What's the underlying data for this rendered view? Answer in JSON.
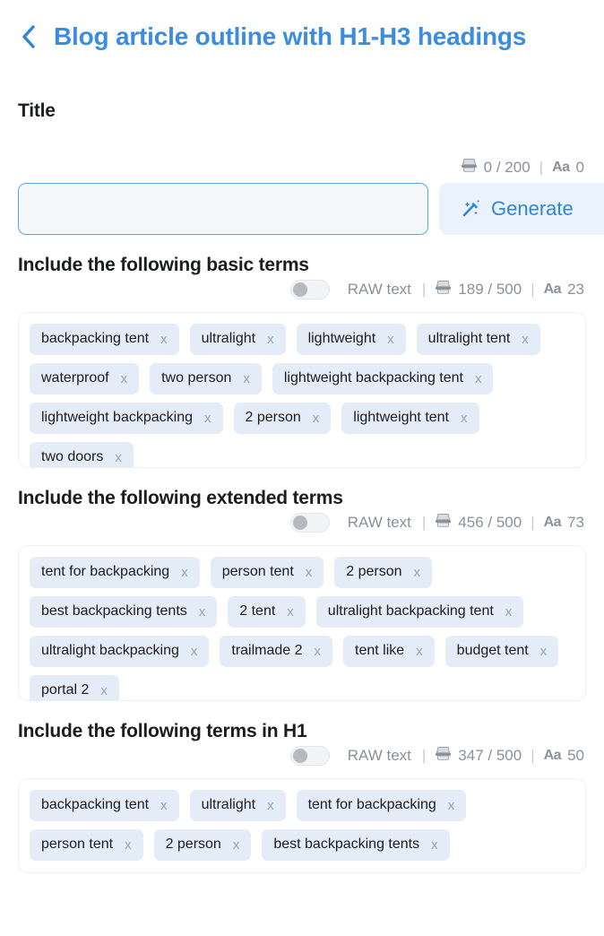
{
  "header": {
    "back_icon": "chevron-left-icon",
    "title": "Blog article outline with H1-H3 headings"
  },
  "title_section": {
    "label": "Title",
    "char_icon": "typewriter-icon",
    "char_count": "0 / 200",
    "word_icon_label": "Aa",
    "word_count": "0",
    "input_value": "",
    "input_placeholder": "",
    "generate_label": "Generate",
    "generate_icon": "magic-wand-icon"
  },
  "sections": [
    {
      "heading": "Include the following basic terms",
      "toggle_label": "RAW text",
      "toggle_state": "off",
      "char_count": "189 / 500",
      "word_icon_label": "Aa",
      "word_count": "23",
      "terms": [
        "backpacking tent",
        "ultralight",
        "lightweight",
        "ultralight tent",
        "waterproof",
        "two person",
        "lightweight backpacking tent",
        "lightweight backpacking",
        "2 person",
        "lightweight tent",
        "two doors"
      ]
    },
    {
      "heading": "Include the following extended terms",
      "toggle_label": "RAW text",
      "toggle_state": "off",
      "char_count": "456 / 500",
      "word_icon_label": "Aa",
      "word_count": "73",
      "terms": [
        "tent for backpacking",
        "person tent",
        "2 person",
        "best backpacking tents",
        "2 tent",
        "ultralight backpacking tent",
        "ultralight backpacking",
        "trailmade 2",
        "tent like",
        "budget tent",
        "portal 2"
      ]
    },
    {
      "heading": "Include the following terms in H1",
      "toggle_label": "RAW text",
      "toggle_state": "off",
      "char_count": "347 / 500",
      "word_icon_label": "Aa",
      "word_count": "50",
      "terms": [
        "backpacking tent",
        "ultralight",
        "tent for backpacking",
        "person tent",
        "2 person",
        "best backpacking tents"
      ]
    }
  ],
  "chip_remove_label": "x",
  "colors": {
    "accent_blue": "#2f86d6",
    "title_blue": "#3c8dde",
    "chip_bg": "#e4ecf8",
    "generate_bg": "#e9f2fd",
    "text_dark": "#1b1d21",
    "muted": "#8b9199"
  }
}
